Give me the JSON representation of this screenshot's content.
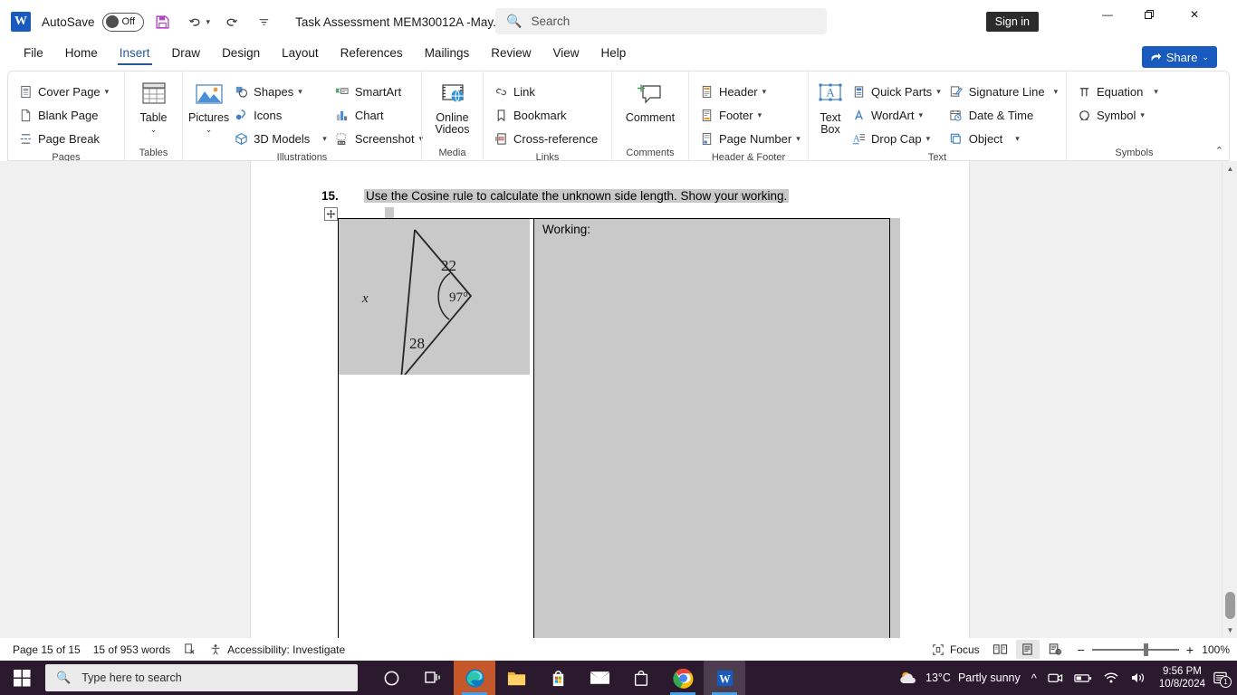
{
  "titlebar": {
    "app_logo": "word-logo",
    "autosave_label": "AutoSave",
    "autosave_state": "Off",
    "document_title": "Task Assessment MEM30012A -May...",
    "search_placeholder": "Search",
    "sign_in": "Sign in",
    "minimize": "—",
    "restore": "❐",
    "close": "✕",
    "quick_access": [
      "save-icon",
      "undo-icon",
      "redo-icon",
      "customize-qat-icon"
    ]
  },
  "tabs": [
    {
      "label": "File",
      "active": false
    },
    {
      "label": "Home",
      "active": false
    },
    {
      "label": "Insert",
      "active": true
    },
    {
      "label": "Draw",
      "active": false
    },
    {
      "label": "Design",
      "active": false
    },
    {
      "label": "Layout",
      "active": false
    },
    {
      "label": "References",
      "active": false
    },
    {
      "label": "Mailings",
      "active": false
    },
    {
      "label": "Review",
      "active": false
    },
    {
      "label": "View",
      "active": false
    },
    {
      "label": "Help",
      "active": false
    }
  ],
  "share": {
    "label": "Share",
    "caret": "⌄"
  },
  "ribbon": {
    "groups": [
      {
        "name": "Pages",
        "items": [
          {
            "label": "Cover Page",
            "caret": true
          },
          {
            "label": "Blank Page",
            "caret": false
          },
          {
            "label": "Page Break",
            "caret": false
          }
        ]
      },
      {
        "name": "Tables",
        "big": [
          {
            "label": "Table",
            "caret": "⌄"
          }
        ]
      },
      {
        "name": "Illustrations",
        "big": [
          {
            "label": "Pictures",
            "caret": "⌄"
          }
        ],
        "items": [
          {
            "label": "Shapes",
            "caret": true
          },
          {
            "label": "Icons",
            "caret": false
          },
          {
            "label": "3D Models",
            "caret": true
          }
        ],
        "items2": [
          {
            "label": "SmartArt",
            "caret": false
          },
          {
            "label": "Chart",
            "caret": false
          },
          {
            "label": "Screenshot",
            "caret": true
          }
        ]
      },
      {
        "name": "Media",
        "big": [
          {
            "label": "Online Videos",
            "caret": ""
          }
        ]
      },
      {
        "name": "Links",
        "items": [
          {
            "label": "Link",
            "caret": false
          },
          {
            "label": "Bookmark",
            "caret": false
          },
          {
            "label": "Cross-reference",
            "caret": false
          }
        ]
      },
      {
        "name": "Comments",
        "big": [
          {
            "label": "Comment",
            "caret": ""
          }
        ]
      },
      {
        "name": "Header & Footer",
        "items": [
          {
            "label": "Header",
            "caret": true
          },
          {
            "label": "Footer",
            "caret": true
          },
          {
            "label": "Page Number",
            "caret": true
          }
        ]
      },
      {
        "name": "Text",
        "big": [
          {
            "label": "Text Box",
            "caret": "⌄"
          }
        ],
        "items": [
          {
            "label": "Quick Parts",
            "caret": true
          },
          {
            "label": "WordArt",
            "caret": true
          },
          {
            "label": "Drop Cap",
            "caret": true
          }
        ],
        "items2": [
          {
            "label": "Signature Line",
            "caret": true
          },
          {
            "label": "Date & Time",
            "caret": false
          },
          {
            "label": "Object",
            "caret": true
          }
        ]
      },
      {
        "name": "Symbols",
        "items": [
          {
            "label": "Equation",
            "caret": true
          },
          {
            "label": "Symbol",
            "caret": true
          }
        ]
      }
    ],
    "collapse_icon": "⌃"
  },
  "document": {
    "question_number": "15.",
    "question_text": "Use the Cosine rule to calculate the unknown side length. Show your working.",
    "working_label": "Working:",
    "table_move_handle": "✛",
    "diagram": {
      "type": "triangle",
      "labels": {
        "side_upper": "22",
        "side_lower": "28",
        "unknown_side": "x",
        "angle": "97°"
      }
    }
  },
  "statusbar": {
    "page": "Page 15 of 15",
    "words": "15 of 953 words",
    "proofing_icon": "proofing-icon",
    "accessibility": "Accessibility: Investigate",
    "focus": "Focus",
    "views": [
      "read-mode-icon",
      "print-layout-icon",
      "web-layout-icon"
    ],
    "zoom_out": "−",
    "zoom_in": "+",
    "zoom_level": "100%"
  },
  "taskbar": {
    "start_icon": "windows-start-icon",
    "search_placeholder": "Type here to search",
    "pinned": [
      "cortana-icon",
      "task-view-icon",
      "edge-icon",
      "file-explorer-icon",
      "microsoft-store-icon",
      "mail-icon",
      "store-bag-icon",
      "chrome-icon",
      "word-icon"
    ],
    "weather_temp": "13°C",
    "weather_desc": "Partly sunny",
    "time": "9:56 PM",
    "date": "10/8/2024",
    "notification_count": "1"
  },
  "colors": {
    "accent": "#185ABD",
    "tab_active": "#2b579a",
    "selection_gray": "#c9c9c9",
    "taskbar": "#2b1a2e"
  }
}
